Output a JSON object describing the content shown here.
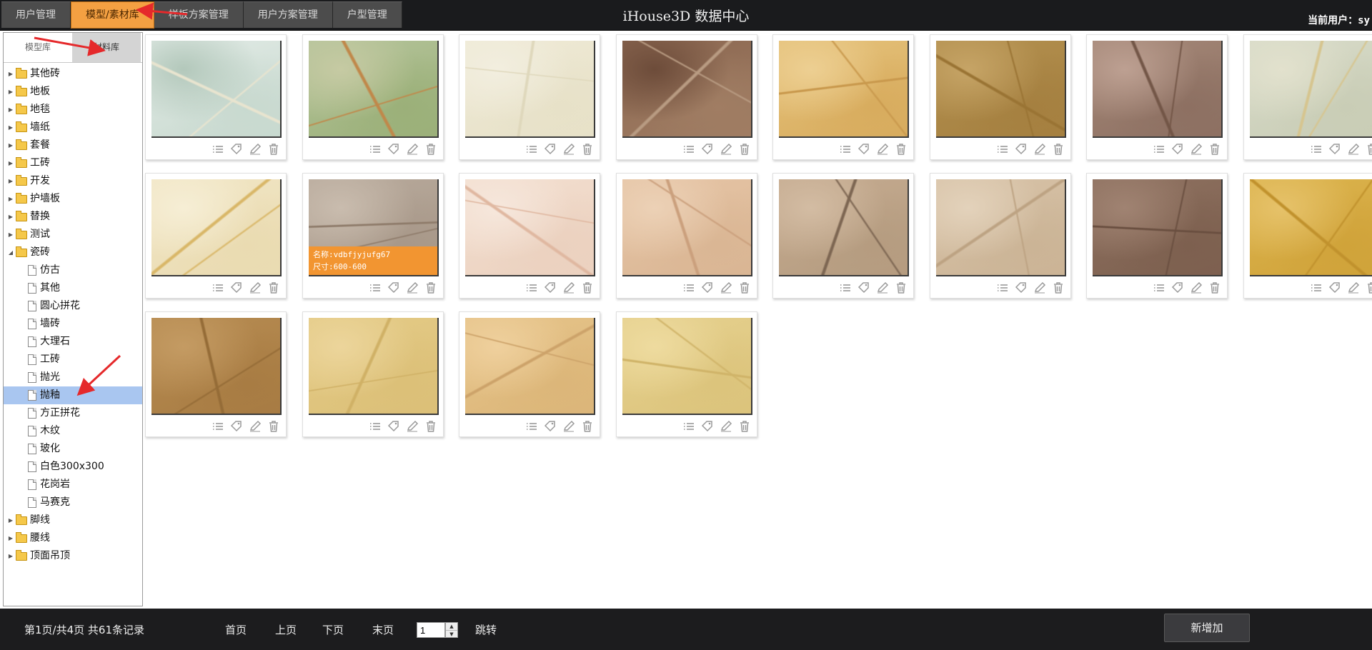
{
  "header": {
    "tabs": [
      {
        "label": "用户管理",
        "active": false
      },
      {
        "label": "模型/素材库",
        "active": true
      },
      {
        "label": "样板方案管理",
        "active": false
      },
      {
        "label": "用户方案管理",
        "active": false
      },
      {
        "label": "户型管理",
        "active": false
      }
    ],
    "title": "iHouse3D 数据中心",
    "current_user": "当前用户：sy"
  },
  "sidebar": {
    "lib_tabs": [
      {
        "label": "模型库"
      },
      {
        "label": "材料库",
        "active": true
      }
    ],
    "tree": [
      {
        "label": "其他砖",
        "type": "folder",
        "expanded": false
      },
      {
        "label": "地板",
        "type": "folder",
        "expanded": false
      },
      {
        "label": "地毯",
        "type": "folder",
        "expanded": false
      },
      {
        "label": "墙纸",
        "type": "folder",
        "expanded": false
      },
      {
        "label": "套餐",
        "type": "folder",
        "expanded": false
      },
      {
        "label": "工砖",
        "type": "folder",
        "expanded": false
      },
      {
        "label": "开发",
        "type": "folder",
        "expanded": false
      },
      {
        "label": "护墙板",
        "type": "folder",
        "expanded": false
      },
      {
        "label": "替换",
        "type": "folder",
        "expanded": false
      },
      {
        "label": "测试",
        "type": "folder",
        "expanded": false
      },
      {
        "label": "瓷砖",
        "type": "folder",
        "expanded": true
      },
      {
        "label": "仿古",
        "type": "doc"
      },
      {
        "label": "其他",
        "type": "doc"
      },
      {
        "label": "圆心拼花",
        "type": "doc"
      },
      {
        "label": "墙砖",
        "type": "doc"
      },
      {
        "label": "大理石",
        "type": "doc"
      },
      {
        "label": "工砖",
        "type": "doc"
      },
      {
        "label": "抛光",
        "type": "doc"
      },
      {
        "label": "抛釉",
        "type": "doc",
        "selected": true
      },
      {
        "label": "方正拼花",
        "type": "doc"
      },
      {
        "label": "木纹",
        "type": "doc"
      },
      {
        "label": "玻化",
        "type": "doc"
      },
      {
        "label": "白色300x300",
        "type": "doc"
      },
      {
        "label": "花岗岩",
        "type": "doc"
      },
      {
        "label": "马赛克",
        "type": "doc"
      },
      {
        "label": "脚线",
        "type": "folder",
        "expanded": false
      },
      {
        "label": "腰线",
        "type": "folder",
        "expanded": false
      },
      {
        "label": "顶面吊顶",
        "type": "folder",
        "expanded": false
      }
    ]
  },
  "materials": [
    {
      "colors": [
        "#e2ebe6",
        "#c8d9cf",
        "#b3c8bb",
        "#e8e4cf"
      ]
    },
    {
      "colors": [
        "#b5c49b",
        "#9bb079",
        "#c6caa3",
        "#c0884a"
      ]
    },
    {
      "colors": [
        "#efead6",
        "#e7e1c8",
        "#f2eedf",
        "#dfd8bc"
      ]
    },
    {
      "colors": [
        "#8a6650",
        "#a07d63",
        "#6d4c3a",
        "#b89b82"
      ]
    },
    {
      "colors": [
        "#e5c27b",
        "#d8ac5e",
        "#edcf92",
        "#c9994d"
      ]
    },
    {
      "colors": [
        "#b3904f",
        "#a58040",
        "#c6a466",
        "#9a7434"
      ]
    },
    {
      "colors": [
        "#a58878",
        "#8d7062",
        "#bda092",
        "#735647"
      ]
    },
    {
      "colors": [
        "#d8dbc9",
        "#c9cdb6",
        "#e2e1cd",
        "#d6c58f"
      ]
    },
    {
      "colors": [
        "#f1e6c6",
        "#eadbb1",
        "#f6eed5",
        "#d9b768"
      ]
    },
    {
      "colors": [
        "#b8aa9c",
        "#a89889",
        "#c9bcae",
        "#8f7c6b"
      ],
      "name": "名称:vdbfjyjufg67",
      "size": "尺寸:600-600"
    },
    {
      "colors": [
        "#f3dfd0",
        "#ebd1bf",
        "#f6e7dc",
        "#e0b8a1"
      ]
    },
    {
      "colors": [
        "#e6c5a6",
        "#dab694",
        "#ecd1b6",
        "#cba07d"
      ]
    },
    {
      "colors": [
        "#c5ab90",
        "#b59c80",
        "#d3bca3",
        "#7d6652"
      ]
    },
    {
      "colors": [
        "#d8c3a8",
        "#cbb496",
        "#e3d2bb",
        "#bda383"
      ]
    },
    {
      "colors": [
        "#8e7160",
        "#7d604f",
        "#a08372",
        "#6a4f40"
      ]
    },
    {
      "colors": [
        "#dcb44e",
        "#d0a33a",
        "#e6c26a",
        "#c1922d"
      ]
    },
    {
      "colors": [
        "#b78c52",
        "#a87c43",
        "#c49b63",
        "#956c37"
      ]
    },
    {
      "colors": [
        "#e4cb87",
        "#dcc078",
        "#ecd59b",
        "#d0b166"
      ]
    },
    {
      "colors": [
        "#e6c48a",
        "#dcb679",
        "#efd09d",
        "#cda36a"
      ]
    },
    {
      "colors": [
        "#e6d18f",
        "#dcc47c",
        "#eedb9f",
        "#d0b469"
      ]
    }
  ],
  "footer": {
    "page_info": "第1页/共4页 共61条记录",
    "first": "首页",
    "prev": "上页",
    "next": "下页",
    "last": "末页",
    "page_value": "1",
    "jump": "跳转",
    "add_button": "新增加"
  },
  "colors": {
    "header_bg": "#1a1b1d",
    "active_tab": "#f4a042",
    "selected_node": "#a9c6f0",
    "overlay": "#f29531"
  }
}
